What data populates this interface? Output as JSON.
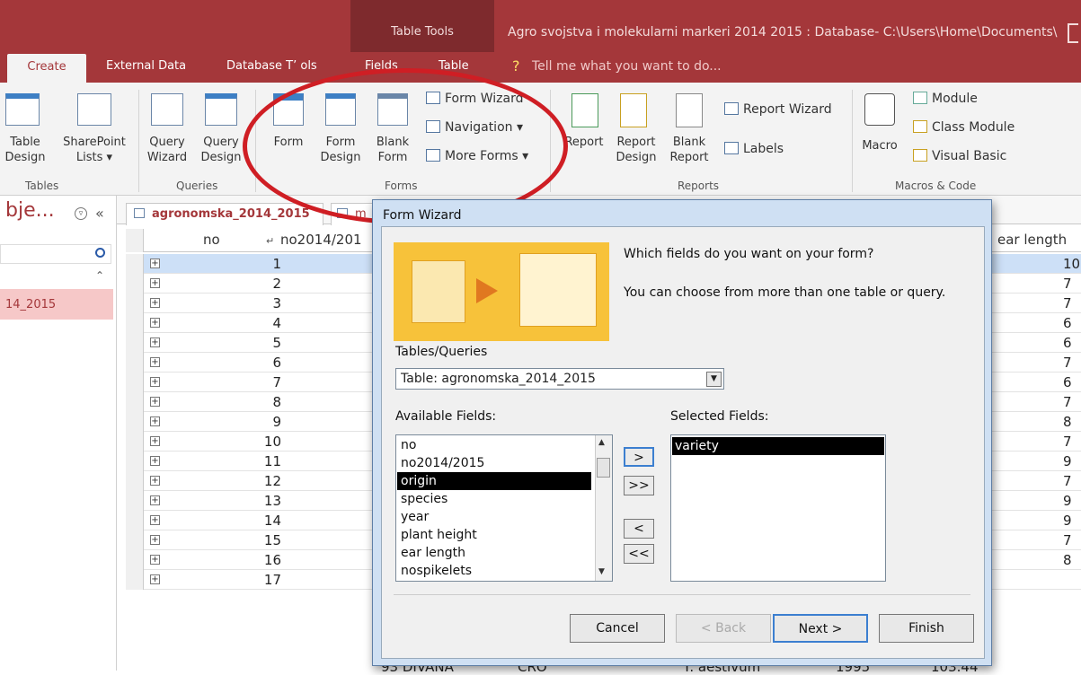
{
  "title_bar": {
    "context_tab": "Table Tools",
    "app_title": "Agro svojstva i molekularni markeri 2014 2015 : Database- C:\\Users\\Home\\Documents\\"
  },
  "tabs": {
    "create": "Create",
    "external_data": "External Data",
    "database_tools": "Database T’ ols",
    "fields": "Fields",
    "table": "Table",
    "tell_me": "Tell me what you want to do..."
  },
  "ribbon": {
    "tables": {
      "label": "Tables",
      "table_design": "Table\nDesign",
      "sharepoint_lists": "SharePoint\nLists ▾"
    },
    "queries": {
      "label": "Queries",
      "query_wizard": "Query\nWizard",
      "query_design": "Query\nDesign"
    },
    "forms": {
      "label": "Forms",
      "form": "Form",
      "form_design": "Form\nDesign",
      "blank_form": "Blank\nForm",
      "form_wizard": "Form Wizard",
      "navigation": "Navigation ▾",
      "more_forms": "More Forms ▾"
    },
    "reports": {
      "label": "Reports",
      "report": "Report",
      "report_design": "Report\nDesign",
      "blank_report": "Blank\nReport",
      "report_wizard": "Report Wizard",
      "labels": "Labels"
    },
    "macros": {
      "label": "Macros & Code",
      "macro": "Macro",
      "module": "Module",
      "class_module": "Class Module",
      "visual_basic": "Visual Basic"
    }
  },
  "nav_pane": {
    "title": "bje...",
    "collapse_glyph": "«",
    "menu_glyph": "▿",
    "item": "14_2015"
  },
  "doc_tabs": {
    "tab1": "agronomska_2014_2015",
    "tab2": "m"
  },
  "grid": {
    "col_no": "no",
    "col_no2014": "no2014/201",
    "col_ear_length": "ear length",
    "rows": [
      "1",
      "2",
      "3",
      "4",
      "5",
      "6",
      "7",
      "8",
      "9",
      "10",
      "11",
      "12",
      "13",
      "14",
      "15",
      "16",
      "17"
    ],
    "right_values": [
      "10",
      "7",
      "7",
      "6",
      "6",
      "7",
      "6",
      "7",
      "8",
      "7",
      "9",
      "7",
      "9",
      "9",
      "7",
      "8",
      ""
    ],
    "bottom_row_partial": [
      "93 DIVANA",
      "CRO",
      "T. aestivum",
      "1995",
      "103.44"
    ]
  },
  "dialog": {
    "title": "Form Wizard",
    "question": "Which fields do you want on your form?",
    "hint": "You can choose from more than one table or query.",
    "tables_queries_label": "Tables/Queries",
    "tables_queries_value": "Table: agronomska_2014_2015",
    "available_label": "Available Fields:",
    "selected_label": "Selected Fields:",
    "available_fields": [
      "no",
      "no2014/2015",
      "origin",
      "species",
      "year",
      "plant height",
      "ear length",
      "nospikelets"
    ],
    "selected_fields": [
      "variety"
    ],
    "move_one": ">",
    "move_all": ">>",
    "remove_one": "<",
    "remove_all": "<<",
    "cancel": "Cancel",
    "back": "< Back",
    "next": "Next >",
    "finish": "Finish"
  }
}
